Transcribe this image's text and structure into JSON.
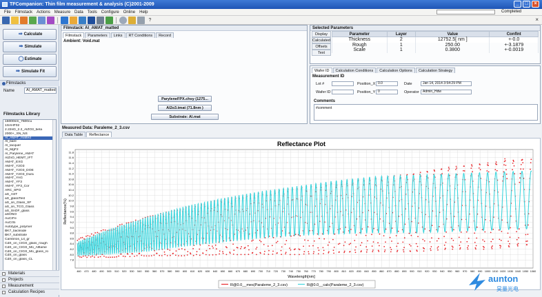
{
  "window": {
    "title": "TFCompanion: Thin film measurement & analysis (C)2001-2009"
  },
  "menu": [
    "File",
    "Filmstack",
    "Actions",
    "Measure",
    "Data",
    "Tools",
    "Configure",
    "Online",
    "Help"
  ],
  "status": {
    "label": "Completed"
  },
  "toolbar": {
    "icons": [
      "save-icon",
      "open-icon",
      "export-icon",
      "plot-icon",
      "table-icon",
      "chart-icon",
      "measure-icon",
      "sample-icon",
      "reference-icon",
      "database-icon",
      "grid-icon",
      "target-icon",
      "settings-icon",
      "wizard-icon",
      "tools-icon",
      "help-icon"
    ],
    "help_glyph": "?",
    "close_glyph": "×"
  },
  "actions": {
    "calculate": "Calculate",
    "simulate": "Simulate",
    "estimate": "Estimate",
    "simulate_fit": "Simulate Fit"
  },
  "filmstacks": {
    "header": "Filmstacks",
    "name_label": "Name",
    "name_value": "Al_AMAT_matted",
    "library_header": "Filmstacks Library",
    "library": [
      "15000nm_7600cu",
      "1SAHF02",
      "2.22nD_2.2_AlZO3_beta",
      "2000+_SN_NS",
      "Al_AMAT_matted",
      "Al_bare",
      "Al_lacquer",
      "Al_MgF2",
      "Al_Parylene_AMAT",
      "AlZnO_HEMT_IFT",
      "AMAT_EXG",
      "AMAT_Y2O3",
      "AMAT_Y2O3_DOE",
      "AMAT_Y2O3_Dura",
      "AMAT_YAG",
      "AMAT_YF3",
      "AMAT_YF3_Cor",
      "ARC_SPO",
      "aS_AST",
      "aS_glassTest",
      "aS_on_Glass_SF",
      "aS_on_TCO_Glass",
      "aS_SnOF_glass",
      "aSONO",
      "AuCrFe",
      "AuCrSi",
      "Autotype_polymer",
      "BK7_backside",
      "BK7_substrate",
      "Cambrios_Lit_gr",
      "CdS_on_CIGS_glass_rough",
      "CdS_on_CIGS_Mo_Alflame",
      "CdS_on_CIGS_Mo_glass_ro",
      "CdS_on_glass",
      "CdS_on_glass_CL"
    ],
    "selected_index": 4
  },
  "nav": [
    "Materials",
    "Projects",
    "Measurement",
    "Calculation Recipes"
  ],
  "filmstack_panel": {
    "title": "Filmstack: Al_AMAT_matted",
    "tabs": [
      "Filmstack",
      "Parameters",
      "Links",
      "RT Conditions",
      "Record"
    ],
    "ambient": "Ambient: Void.mat",
    "layers": [
      "ParyleneFPX.chsy (1275...",
      "Al2o3.tmat (71.8nm )",
      "Substrate: Al.mat"
    ]
  },
  "selected_params": {
    "title": "Selected Parameters",
    "side_buttons": [
      "Display",
      "Calculated",
      "Offsets",
      "Text"
    ],
    "columns": [
      "Parameter",
      "Layer",
      "Value",
      "Conflnt"
    ],
    "rows": [
      [
        "Thickness",
        "2",
        "12752.5[ nm ]",
        "+-0.0"
      ],
      [
        "Rough",
        "1",
        "250.00",
        "+-3.1879"
      ],
      [
        "Scale",
        "1",
        "0.3800",
        "+-0.0019"
      ]
    ]
  },
  "measurement_panel": {
    "tabs": [
      "Wafer ID",
      "Calculation Conditions",
      "Calculation Options",
      "Calculation Strategy"
    ],
    "title": "Measurement ID",
    "lot_label": "Lot #",
    "lot_value": "",
    "posx_label": "Position_X",
    "posx_value": "0.0",
    "date_label": "Date",
    "date_value": "Jan 14, 2014 3:54:29 PM",
    "wafer_label": "Wafer ID",
    "wafer_value": "",
    "posy_label": "Position_Y",
    "posy_value": "0",
    "operator_label": "Operator",
    "operator_value": "Admin_Hdw",
    "comments_label": "Comments",
    "comments_value": "#comment"
  },
  "measured": {
    "title": "Measured Data: Paraleme_2_3.csv",
    "tabs": [
      "Data Table",
      "Reflectance"
    ],
    "active_tab": 1
  },
  "chart_data": {
    "type": "line",
    "title": "Reflectance Plot",
    "xlabel": "Wavelength[nm]",
    "ylabel": "Reflectance(%)",
    "xlim": [
      455,
      1060
    ],
    "ylim": [
      7.5,
      11.9
    ],
    "xticks": [
      460,
      470,
      480,
      490,
      500,
      510,
      520,
      530,
      540,
      550,
      560,
      570,
      580,
      590,
      600,
      610,
      620,
      630,
      640,
      650,
      660,
      670,
      680,
      690,
      700,
      710,
      720,
      730,
      740,
      750,
      760,
      770,
      780,
      790,
      800,
      810,
      820,
      830,
      840,
      850,
      860,
      870,
      880,
      890,
      900,
      910,
      920,
      930,
      940,
      950,
      960,
      970,
      980,
      990,
      1000,
      1010,
      1020,
      1030,
      1040,
      1050,
      1060
    ],
    "yticks": [
      7.8,
      8.0,
      8.2,
      8.4,
      8.6,
      8.8,
      9.0,
      9.2,
      9.4,
      9.6,
      9.8,
      10.0,
      10.2,
      10.4,
      10.6,
      10.8,
      11.0,
      11.2,
      11.4,
      11.6,
      11.8
    ],
    "grid": true,
    "legend_position": "bottom",
    "series": [
      {
        "name": "R@0.0__mes(Paraleme_2_3.csv)",
        "color": "#e8282c",
        "marker": "dots",
        "envelope": {
          "x": [
            460,
            500,
            550,
            600,
            650,
            700,
            750,
            800,
            850,
            900,
            950,
            1000,
            1050
          ],
          "min": [
            7.9,
            7.9,
            7.95,
            7.95,
            8.0,
            8.0,
            8.0,
            8.05,
            8.1,
            8.1,
            8.2,
            8.2,
            8.35
          ],
          "max": [
            8.6,
            9.0,
            9.4,
            9.75,
            10.05,
            10.3,
            10.5,
            10.7,
            10.85,
            11.0,
            11.25,
            11.4,
            11.55
          ]
        },
        "peaks": [
          {
            "x": 1023,
            "y": 11.6
          },
          {
            "x": 1045,
            "y": 11.55
          }
        ]
      },
      {
        "name": "R@0.0__calc(Paraleme_2_3.csv)",
        "color": "#3fd5dd",
        "marker": "line",
        "envelope": {
          "x": [
            460,
            500,
            550,
            600,
            650,
            700,
            750,
            800,
            850,
            900,
            950,
            1000,
            1050
          ],
          "min": [
            7.95,
            8.0,
            8.1,
            8.3,
            8.45,
            8.6,
            8.7,
            8.75,
            8.8,
            8.8,
            8.85,
            8.9,
            8.95
          ],
          "max": [
            8.5,
            8.95,
            9.4,
            9.8,
            10.1,
            10.35,
            10.55,
            10.75,
            10.9,
            10.95,
            11.0,
            11.05,
            11.1
          ]
        }
      }
    ]
  },
  "brand": {
    "name": "aunton",
    "subtitle": "昊量光电",
    "color": "#2f8be0"
  }
}
